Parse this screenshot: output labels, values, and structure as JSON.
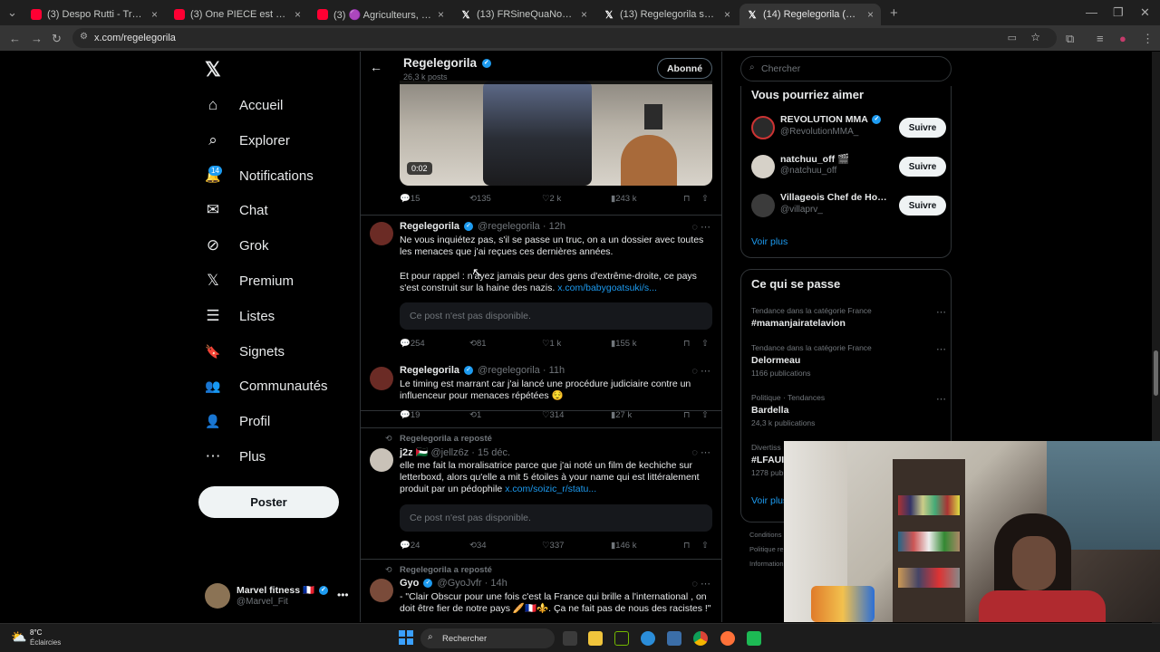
{
  "browser": {
    "tabs": [
      {
        "title": "(3) Despo Rutti - Trashhh - You",
        "icon": "youtube"
      },
      {
        "title": "(3) One PIECE est meilleur sans",
        "icon": "youtube"
      },
      {
        "title": "(3) 🟣 Agriculteurs, vote du bu",
        "icon": "youtube"
      },
      {
        "title": "(13) FRSineQuaNon sur X : \"@T",
        "icon": "x"
      },
      {
        "title": "(13) Regelegorila sur X : \"Moins",
        "icon": "x"
      },
      {
        "title": "(14) Regelegorila (@regelegori",
        "icon": "x"
      }
    ],
    "url": "x.com/regelegorila"
  },
  "nav": {
    "items": [
      {
        "label": "Accueil",
        "icon": "home-icon",
        "glyph": "⌂"
      },
      {
        "label": "Explorer",
        "icon": "search-icon",
        "glyph": "⌕"
      },
      {
        "label": "Notifications",
        "icon": "bell-icon",
        "glyph": "🔔"
      },
      {
        "label": "Chat",
        "icon": "mail-icon",
        "glyph": "✉"
      },
      {
        "label": "Grok",
        "icon": "grok-icon",
        "glyph": "⊘"
      },
      {
        "label": "Premium",
        "icon": "x-icon",
        "glyph": "𝕏"
      },
      {
        "label": "Listes",
        "icon": "list-icon",
        "glyph": "☰"
      },
      {
        "label": "Signets",
        "icon": "bookmark-icon",
        "glyph": "🔖"
      },
      {
        "label": "Communautés",
        "icon": "people-icon",
        "glyph": "👥"
      },
      {
        "label": "Profil",
        "icon": "person-icon",
        "glyph": "👤"
      },
      {
        "label": "Plus",
        "icon": "more-circle-icon",
        "glyph": "⋯"
      }
    ],
    "notification_badge": "14",
    "post_button": "Poster",
    "account": {
      "name": "Marvel fitness 🇫🇷",
      "handle": "@Marvel_Fit"
    }
  },
  "profile_header": {
    "name": "Regelegorila",
    "posts_count": "26,3 k posts",
    "follow_button": "Abonné"
  },
  "video": {
    "timestamp": "0:02"
  },
  "tweets": [
    {
      "stats": {
        "replies": "15",
        "reposts": "135",
        "likes": "2 k",
        "views": "243 k"
      }
    },
    {
      "name": "Regelegorila",
      "handle": "@regelegorila",
      "time": "· 12h",
      "text1": "Ne vous inquiétez pas, s'il se passe un truc, on a un dossier avec toutes les menaces que j'ai reçues ces dernières années.",
      "text2": "Et pour rappel : n'ayez jamais peur des gens d'extrême-droite, ce pays s'est construit sur la haine des nazis.",
      "link": "x.com/babygoatsuki/s...",
      "unavailable": "Ce post n'est pas disponible.",
      "stats": {
        "replies": "254",
        "reposts": "81",
        "likes": "1 k",
        "views": "155 k"
      }
    },
    {
      "name": "Regelegorila",
      "handle": "@regelegorila",
      "time": "· 11h",
      "text1": "Le timing est marrant car j'ai lancé une procédure judiciaire contre un influenceur pour menaces répétées 😌",
      "stats": {
        "replies": "19",
        "reposts": "1",
        "likes": "314",
        "views": "27 k"
      }
    },
    {
      "repost_label": "Regelegorila a reposté",
      "name": "j2z 🇵🇸",
      "handle": "@jellz6z",
      "time": "· 15 déc.",
      "text1": "elle me fait la moralisatrice parce que j'ai noté un film de kechiche sur letterboxd, alors qu'elle a mit 5 étoiles à your name qui est littéralement produit par un pédophile",
      "link": "x.com/soizic_r/statu...",
      "unavailable": "Ce post n'est pas disponible.",
      "stats": {
        "replies": "24",
        "reposts": "34",
        "likes": "337",
        "views": "146 k"
      }
    },
    {
      "repost_label": "Regelegorila a reposté",
      "name": "Gyo",
      "handle": "@GyoJvfr",
      "time": "· 14h",
      "text1": "- \"Clair Obscur pour une fois c'est la France qui brille a l'international , on doit être fier de notre pays 🥖🇫🇷⚜️. Ça ne fait pas de nous des racistes !\""
    }
  ],
  "right": {
    "search_placeholder": "Chercher",
    "suggestions_title": "Vous pourriez aimer",
    "suggestions": [
      {
        "name": "REVOLUTION MMA",
        "handle": "@RevolutionMMA_",
        "button": "Suivre"
      },
      {
        "name": "natchuu_off 🎬",
        "handle": "@natchuu_off",
        "button": "Suivre"
      },
      {
        "name": "Villageois Chef de Hoe...",
        "handle": "@villaprv_",
        "button": "Suivre"
      }
    ],
    "see_more": "Voir plus",
    "trends_title": "Ce qui se passe",
    "trends": [
      {
        "context": "Tendance dans la catégorie France",
        "topic": "#mamanjairatelavion",
        "count": ""
      },
      {
        "context": "Tendance dans la catégorie France",
        "topic": "Delormeau",
        "count": "1166 publications"
      },
      {
        "context": "Politique · Tendances",
        "topic": "Bardella",
        "count": "24,3 k publications"
      },
      {
        "context": "Divertiss",
        "topic": "#LFAUI",
        "count": "1278 pub"
      }
    ],
    "trends_see_more": "Voir plus",
    "footer": [
      "Conditions",
      "Politique re",
      "Information"
    ]
  },
  "taskbar": {
    "weather_temp": "8°C",
    "weather_desc": "Éclaircies",
    "search_label": "Rechercher"
  }
}
